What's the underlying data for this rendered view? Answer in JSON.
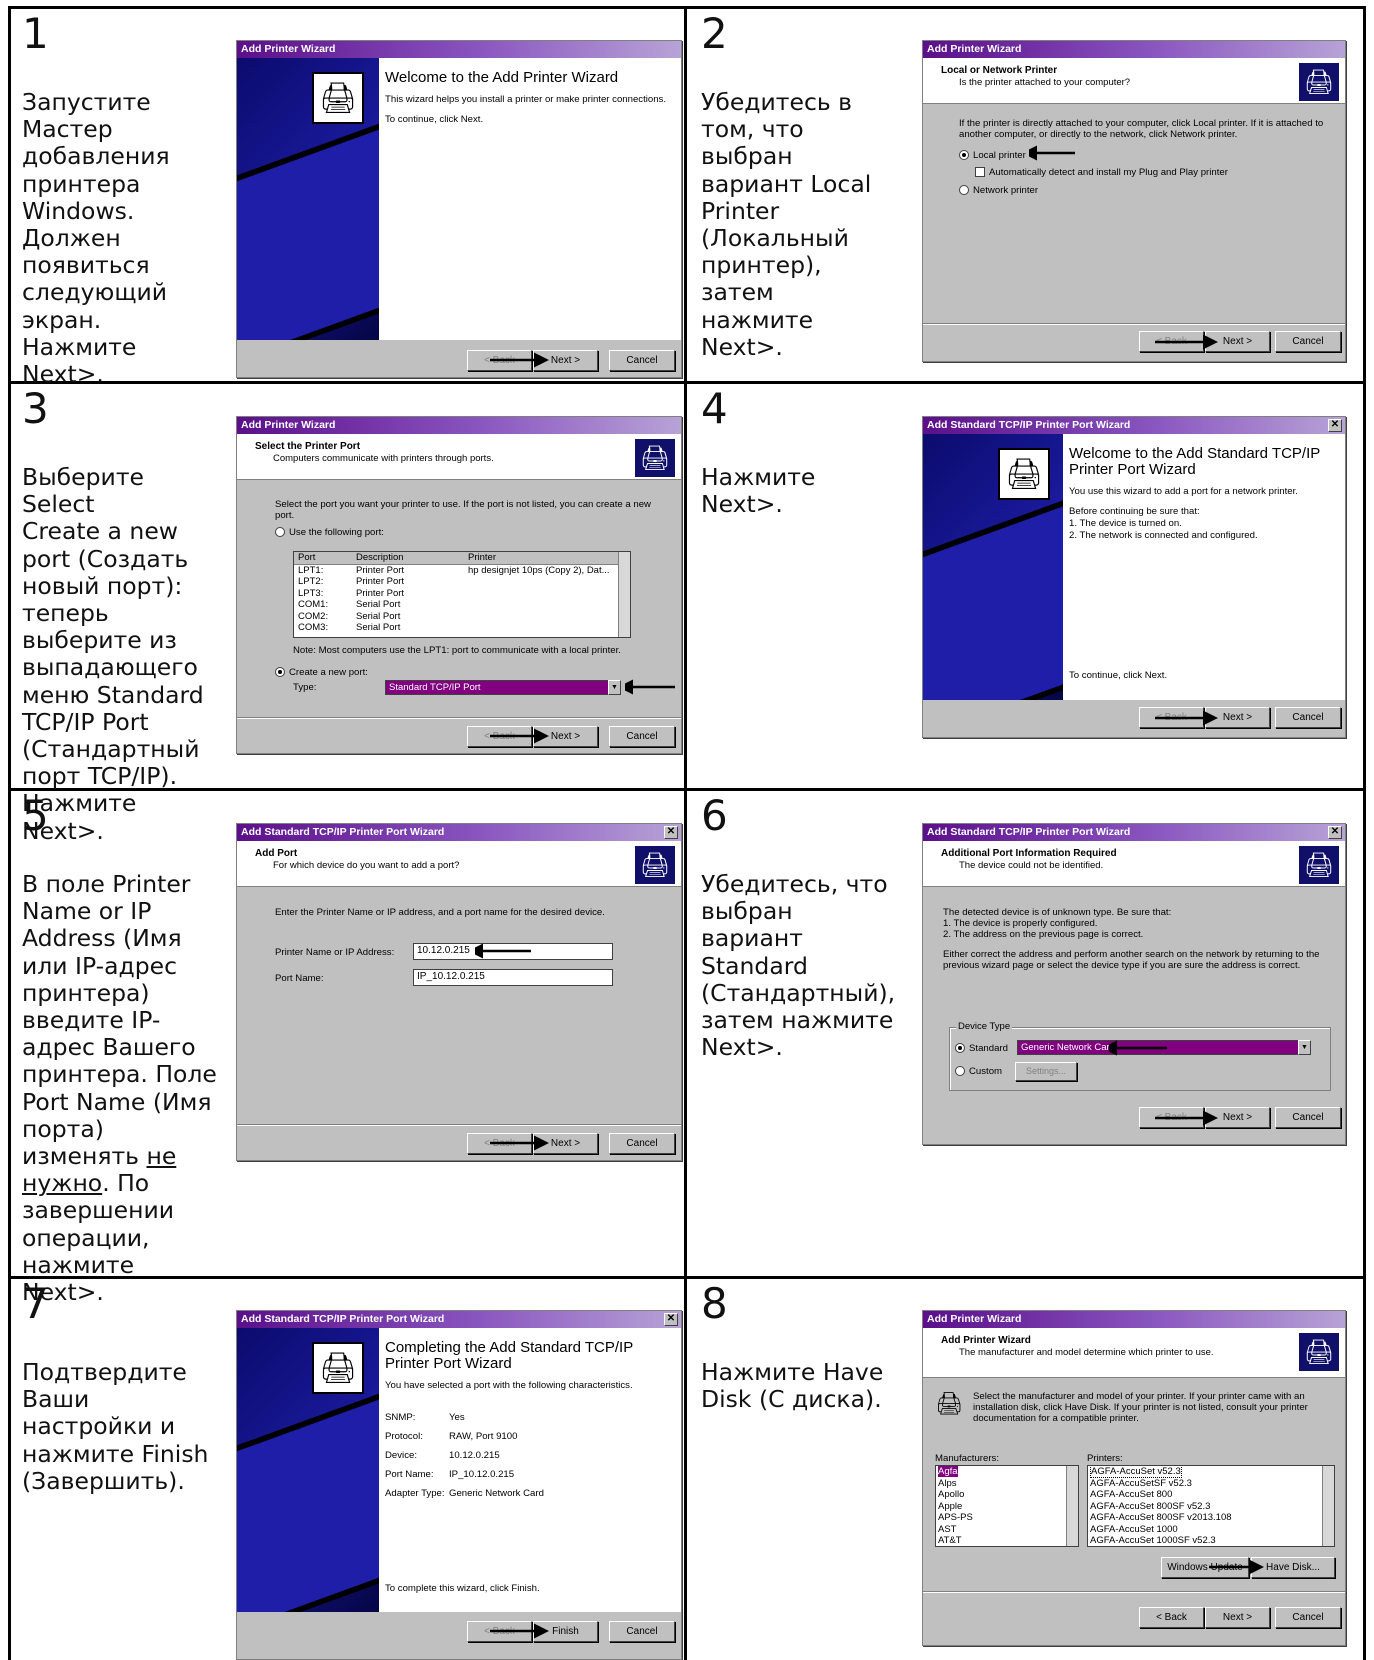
{
  "steps": [
    {
      "num": "1",
      "lines": [
        "Запустите",
        "Мастер",
        "добавления",
        "принтера",
        "Windows.",
        "Должен",
        "появиться",
        "следующий",
        "экран. Нажмите",
        "Next>."
      ]
    },
    {
      "num": "2",
      "lines": [
        "Убедитесь в",
        "том, что",
        "выбран",
        "вариант Local",
        "Printer",
        "(Локальный",
        "принтер), затем",
        "нажмите Next>."
      ]
    },
    {
      "num": "3",
      "lines": [
        "Выберите Select",
        "Create a new",
        "port (Создать",
        "новый порт):",
        "теперь",
        "выберите из",
        "выпадающего",
        "меню Standard",
        "TCP/IP Port",
        "(Стандартный",
        "порт TCP/IP).",
        "Нажмите Next>."
      ]
    },
    {
      "num": "4",
      "lines": [
        "Нажмите",
        "Next>."
      ]
    },
    {
      "num": "5",
      "lines": [
        "В поле Printer",
        "Name or IP",
        "Address (Имя",
        "или IP-адрес",
        "принтера)",
        "введите IP-",
        "адрес Вашего",
        "принтера. Поле",
        "Port Name (Имя",
        "порта)"
      ],
      "l11_a": "изменять ",
      "l11_u": "не",
      "l12_u": "нужно",
      "l12_b": ". По",
      "lines2": [
        "завершении",
        "операции,",
        "нажмите Next>."
      ]
    },
    {
      "num": "6",
      "lines": [
        "Убедитесь, что",
        "выбран",
        "вариант",
        "Standard",
        "(Стандартный),",
        "затем нажмите",
        "Next>."
      ]
    },
    {
      "num": "7",
      "lines": [
        "Подтвердите",
        "Ваши",
        "настройки и",
        "нажмите Finish",
        "(Завершить)."
      ]
    },
    {
      "num": "8",
      "lines": [
        "Нажмите Have",
        "Disk (С диска)."
      ]
    }
  ],
  "d1": {
    "title": "Add Printer Wizard",
    "heading": "Welcome to the Add Printer Wizard",
    "p1": "This wizard helps you install a printer or make printer connections.",
    "p2": "To continue, click Next.",
    "back": "< Back",
    "next": "Next >",
    "cancel": "Cancel"
  },
  "d2": {
    "title": "Add Printer Wizard",
    "h": "Local or Network Printer",
    "sub": "Is the printer attached to your computer?",
    "p": "If the printer is directly attached to your computer, click Local printer.  If it is attached to another computer, or directly to the network, click Network printer.",
    "local": "Local printer",
    "auto": "Automatically detect and install my Plug and Play printer",
    "network": "Network printer",
    "back": "< Back",
    "next": "Next >",
    "cancel": "Cancel"
  },
  "d3": {
    "title": "Add Printer Wizard",
    "h": "Select the Printer Port",
    "sub": "Computers communicate with printers through ports.",
    "p": "Select the port you want your printer to use.  If the port is not listed, you can create a new port.",
    "use": "Use the following port:",
    "cols": [
      "Port",
      "Description",
      "Printer"
    ],
    "rows": [
      [
        "LPT1:",
        "Printer Port",
        "hp designjet 10ps (Copy 2), Dat..."
      ],
      [
        "LPT2:",
        "Printer Port",
        ""
      ],
      [
        "LPT3:",
        "Printer Port",
        ""
      ],
      [
        "COM1:",
        "Serial Port",
        ""
      ],
      [
        "COM2:",
        "Serial Port",
        ""
      ],
      [
        "COM3:",
        "Serial Port",
        ""
      ]
    ],
    "note": "Note: Most computers use the LPT1: port to communicate with a local printer.",
    "create": "Create a new port:",
    "type": "Type:",
    "typeval": "Standard TCP/IP Port",
    "back": "< Back",
    "next": "Next >",
    "cancel": "Cancel"
  },
  "d4": {
    "title": "Add Standard TCP/IP Printer Port Wizard",
    "heading": "Welcome to the Add Standard TCP/IP Printer Port Wizard",
    "p1": "You use this wizard to add a port for a network printer.",
    "p2": "Before continuing be sure that:",
    "p3": "1.  The device is turned on.",
    "p4": "2.  The network is connected and configured.",
    "p5": "To continue, click Next.",
    "back": "< Back",
    "next": "Next >",
    "cancel": "Cancel"
  },
  "d5": {
    "title": "Add Standard TCP/IP Printer Port Wizard",
    "h": "Add Port",
    "sub": "For which device do you want to add a port?",
    "p": "Enter the Printer Name or IP address, and a port name for the desired device.",
    "l1": "Printer Name or IP Address:",
    "v1": "10.12.0.215",
    "l2": "Port Name:",
    "v2": "IP_10.12.0.215",
    "back": "< Back",
    "next": "Next >",
    "cancel": "Cancel"
  },
  "d6": {
    "title": "Add Standard TCP/IP Printer Port Wizard",
    "h": "Additional Port Information Required",
    "sub": "The device could not be identified.",
    "p1": "The detected device is of unknown type.  Be sure that:",
    "p2": "1.  The device is properly configured.",
    "p3": "2.  The address on the previous page is correct.",
    "p4": "Either correct the address and perform another search on the network by returning to the previous wizard page or select the device type if you are sure the address is correct.",
    "grp": "Device Type",
    "std": "Standard",
    "stdval": "Generic Network Card",
    "custom": "Custom",
    "settings": "Settings...",
    "back": "< Back",
    "next": "Next >",
    "cancel": "Cancel"
  },
  "d7": {
    "title": "Add Standard TCP/IP Printer Port Wizard",
    "heading": "Completing the Add Standard TCP/IP Printer Port Wizard",
    "p1": "You have selected a port with the following characteristics.",
    "kv": [
      [
        "SNMP:",
        "Yes"
      ],
      [
        "Protocol:",
        "RAW, Port 9100"
      ],
      [
        "Device:",
        "10.12.0.215"
      ],
      [
        "Port Name:",
        "IP_10.12.0.215"
      ],
      [
        "Adapter Type:",
        "Generic Network Card"
      ]
    ],
    "p2": "To complete this wizard, click Finish.",
    "back": "< Back",
    "finish": "Finish",
    "cancel": "Cancel"
  },
  "d8": {
    "title": "Add Printer Wizard",
    "h": "Add Printer Wizard",
    "sub": "The manufacturer and model determine which printer to use.",
    "p": "Select the manufacturer and model of your printer. If your printer came with an installation disk, click Have Disk. If your printer is not listed, consult your printer documentation for a compatible printer.",
    "mlabel": "Manufacturers:",
    "plabel": "Printers:",
    "mans": [
      "Agfa",
      "Alps",
      "Apollo",
      "Apple",
      "APS-PS",
      "AST",
      "AT&T"
    ],
    "prns": [
      "AGFA-AccuSet v52.3",
      "AGFA-AccuSetSF v52.3",
      "AGFA-AccuSet 800",
      "AGFA-AccuSet 800SF v52.3",
      "AGFA-AccuSet 800SF v2013.108",
      "AGFA-AccuSet 1000",
      "AGFA-AccuSet 1000SF v52.3"
    ],
    "wu": "Windows Update",
    "hd": "Have Disk...",
    "back": "< Back",
    "next": "Next >",
    "cancel": "Cancel"
  }
}
